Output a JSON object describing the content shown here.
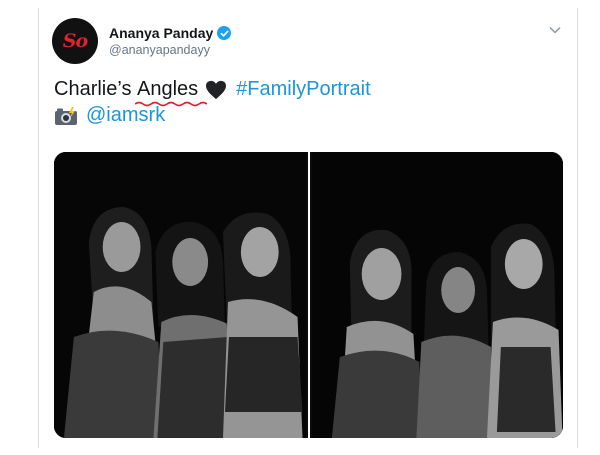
{
  "profile": {
    "display_name": "Ananya Panday",
    "handle": "@ananyapandayy",
    "avatar_logo": "So"
  },
  "tweet": {
    "text_part1": "Charlie’s ",
    "misspelled_word": "Angles",
    "heart_icon": "black-heart-icon",
    "hashtag": "#FamilyPortrait",
    "camera_icon": "camera-with-flash-icon",
    "mention": "@iamsrk"
  },
  "media": {
    "photos": [
      "photo-left",
      "photo-right"
    ]
  },
  "colors": {
    "link": "#1b95e0",
    "verified": "#1da1f2",
    "spellcheck": "#e0202a",
    "text": "#14171a",
    "muted": "#657786"
  }
}
